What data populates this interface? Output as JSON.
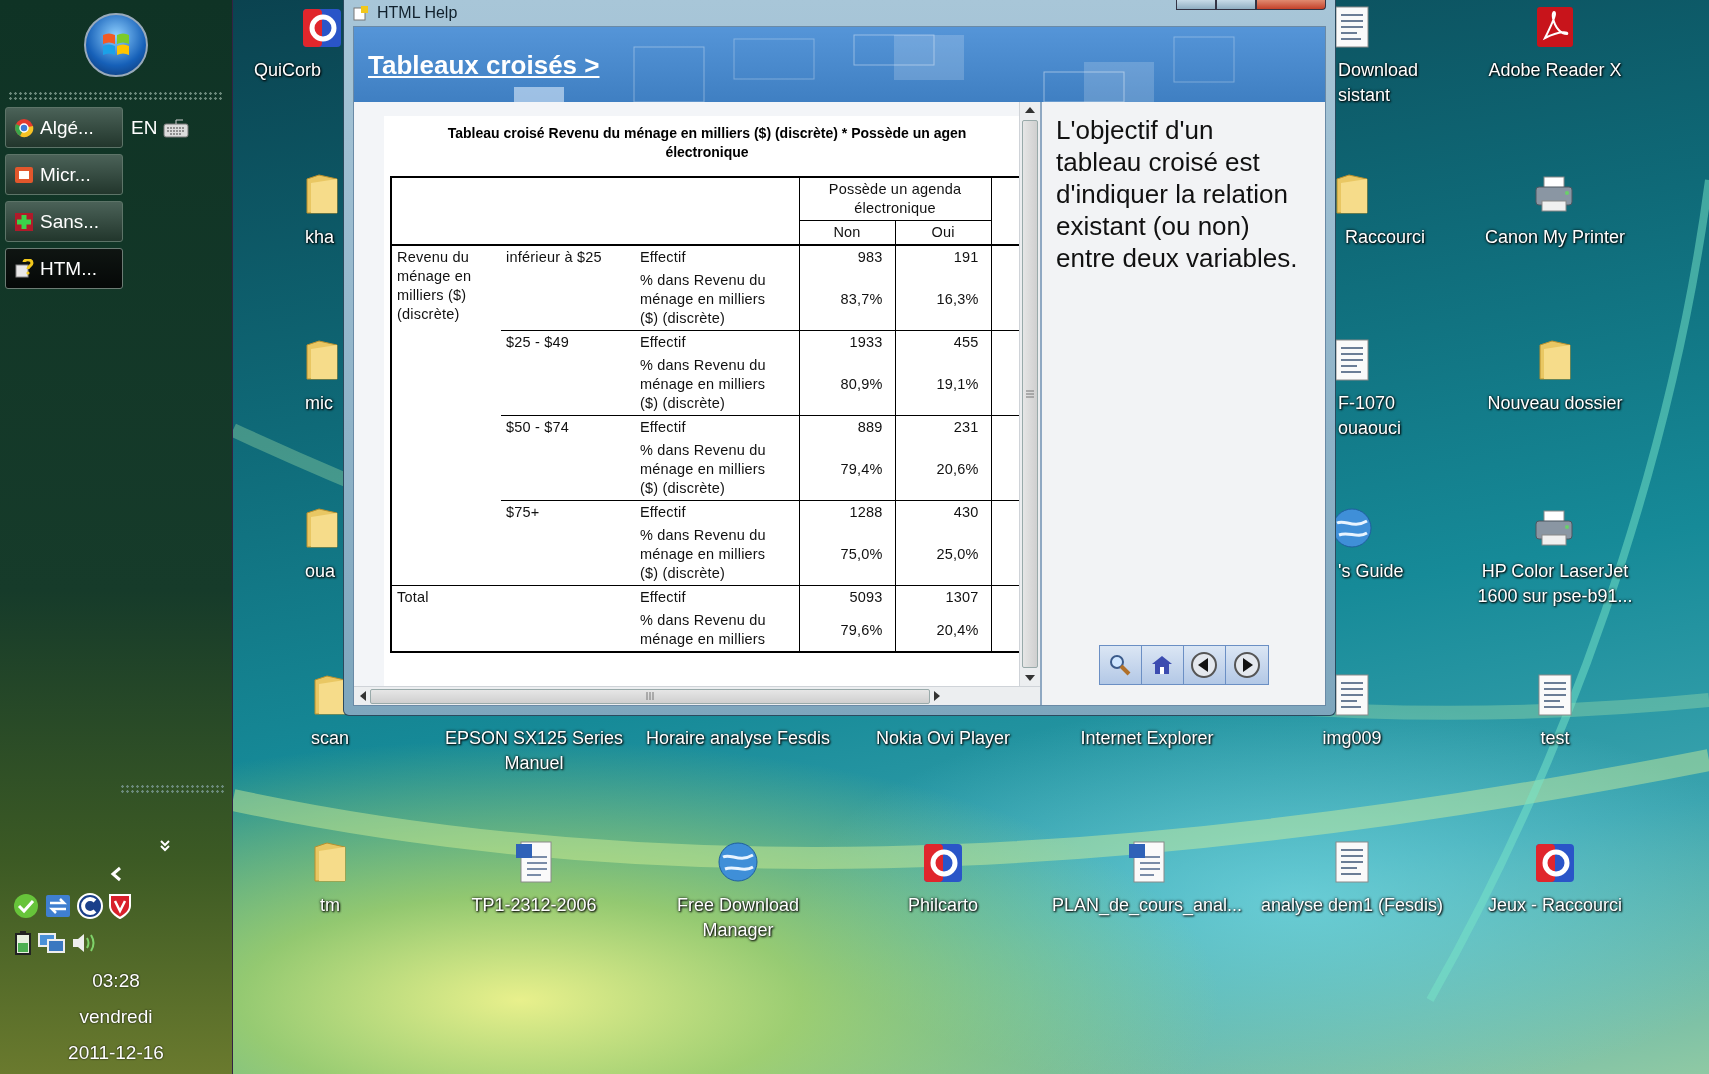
{
  "taskbar": {
    "tasks": [
      {
        "label": "Algé...",
        "selected": false
      },
      {
        "label": "Micr...",
        "selected": false
      },
      {
        "label": "Sans...",
        "selected": false
      },
      {
        "label": "HTM...",
        "selected": true
      }
    ],
    "language": "EN",
    "clock": {
      "time": "03:28",
      "day": "vendredi",
      "date": "2011-12-16"
    }
  },
  "desktop_icons": [
    {
      "kind": "app",
      "lines": [
        "QuiCorb"
      ]
    },
    {
      "kind": "document",
      "lines": [
        "Download",
        "sistant"
      ]
    },
    {
      "kind": "pdf",
      "lines": [
        "Adobe Reader X"
      ]
    },
    {
      "kind": "folder",
      "lines": [
        "kha"
      ]
    },
    {
      "kind": "folder",
      "lines": [
        "Raccourci"
      ]
    },
    {
      "kind": "printer",
      "lines": [
        "Canon My Printer"
      ]
    },
    {
      "kind": "folder",
      "lines": [
        "mic"
      ]
    },
    {
      "kind": "document",
      "lines": [
        "F-1070",
        "ouaouci"
      ]
    },
    {
      "kind": "folder",
      "lines": [
        "Nouveau dossier"
      ]
    },
    {
      "kind": "folder",
      "lines": [
        "oua"
      ]
    },
    {
      "kind": "globe",
      "lines": [
        "'s Guide"
      ]
    },
    {
      "kind": "printer",
      "lines": [
        "HP Color LaserJet",
        "1600 sur pse-b91..."
      ]
    },
    {
      "kind": "folder",
      "lines": [
        "scan"
      ]
    },
    {
      "kind": "none",
      "lines": [
        "EPSON SX125 Series",
        "Manuel"
      ]
    },
    {
      "kind": "none",
      "lines": [
        "Horaire analyse Fesdis"
      ]
    },
    {
      "kind": "none",
      "lines": [
        "Nokia Ovi Player"
      ]
    },
    {
      "kind": "none",
      "lines": [
        "Internet Explorer"
      ]
    },
    {
      "kind": "document",
      "lines": [
        "img009"
      ]
    },
    {
      "kind": "document",
      "lines": [
        "test"
      ]
    },
    {
      "kind": "folder",
      "lines": [
        "tm"
      ]
    },
    {
      "kind": "word",
      "lines": [
        "TP1-2312-2006"
      ]
    },
    {
      "kind": "globe",
      "lines": [
        "Free Download",
        "Manager"
      ]
    },
    {
      "kind": "app",
      "lines": [
        "Philcarto"
      ]
    },
    {
      "kind": "word",
      "lines": [
        "PLAN_de_cours_anal..."
      ]
    },
    {
      "kind": "document",
      "lines": [
        "analyse dem1 (Fesdis)"
      ]
    },
    {
      "kind": "app",
      "lines": [
        "Jeux - Raccourci"
      ]
    }
  ],
  "window": {
    "title": "HTML Help",
    "header_link": "Tableaux croisés >",
    "table": {
      "title_lines": [
        "Tableau croisé Revenu du ménage en milliers ($) (discrète) * Possède un agen",
        "électronique"
      ],
      "column_group": "Possède un agenda électronique",
      "columns": [
        "Non",
        "Oui"
      ],
      "groups": [
        {
          "label": "Revenu du ménage en milliers ($) (discrète)",
          "categories": [
            {
              "label": "inférieur à $25",
              "stats": [
                {
                  "label": "Effectif",
                  "values": [
                    "983",
                    "191"
                  ]
                },
                {
                  "label": "% dans Revenu du ménage en milliers ($) (discrète)",
                  "values": [
                    "83,7%",
                    "16,3%"
                  ]
                }
              ]
            },
            {
              "label": "$25 - $49",
              "stats": [
                {
                  "label": "Effectif",
                  "values": [
                    "1933",
                    "455"
                  ]
                },
                {
                  "label": "% dans Revenu du ménage en milliers ($) (discrète)",
                  "values": [
                    "80,9%",
                    "19,1%"
                  ]
                }
              ]
            },
            {
              "label": "$50 - $74",
              "stats": [
                {
                  "label": "Effectif",
                  "values": [
                    "889",
                    "231"
                  ]
                },
                {
                  "label": "% dans Revenu du ménage en milliers ($) (discrète)",
                  "values": [
                    "79,4%",
                    "20,6%"
                  ]
                }
              ]
            },
            {
              "label": "$75+",
              "stats": [
                {
                  "label": "Effectif",
                  "values": [
                    "1288",
                    "430"
                  ]
                },
                {
                  "label": "% dans Revenu du ménage en milliers ($) (discrète)",
                  "values": [
                    "75,0%",
                    "25,0%"
                  ]
                }
              ]
            }
          ]
        }
      ],
      "total": {
        "label": "Total",
        "stats": [
          {
            "label": "Effectif",
            "values": [
              "5093",
              "1307"
            ]
          },
          {
            "label": "% dans Revenu du ménage en milliers",
            "values": [
              "79,6%",
              "20,4%"
            ]
          }
        ]
      }
    },
    "description": "L'objectif d'un tableau croisé est d'indiquer la relation existant (ou non) entre deux variables."
  }
}
